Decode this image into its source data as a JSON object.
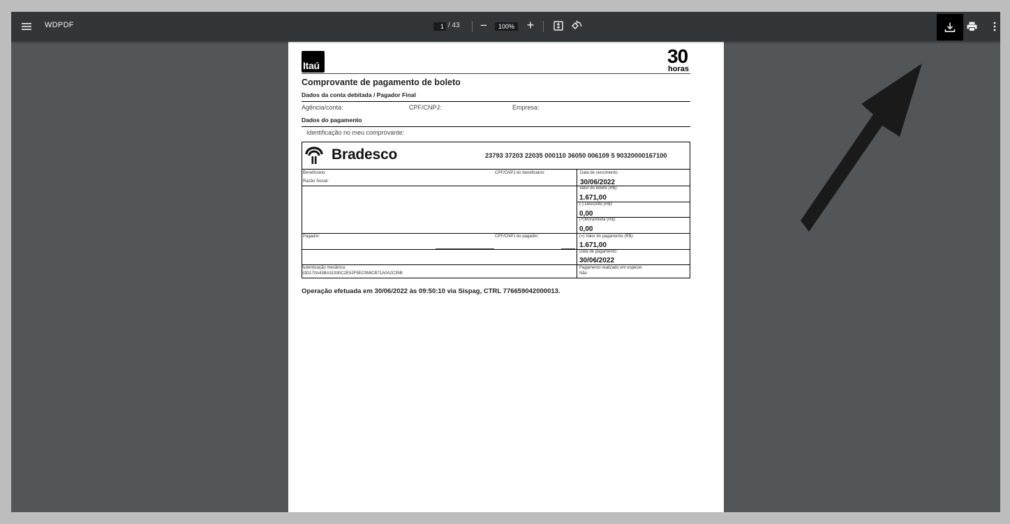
{
  "toolbar": {
    "title": "WDPDF",
    "page_current": "1",
    "page_total": "/ 43",
    "zoom_out": "−",
    "zoom_value": "100%",
    "zoom_in": "+",
    "icons": {
      "menu": "menu-icon",
      "fit": "fit-to-page-icon",
      "rotate": "rotate-icon",
      "download": "download-icon",
      "print": "print-icon",
      "more": "more-vertical-icon"
    }
  },
  "document": {
    "itau_logo": "Itaú",
    "badge_number": "30",
    "badge_word": "horas",
    "heading": "Comprovante de pagamento de boleto",
    "section_debit": "Dados da conta debitada / Pagador Final",
    "agencia_label": "Agência/conta:",
    "cpf_label": "CPF/CNPJ:",
    "empresa_label": "Empresa:",
    "section_payment": "Dados do pagamento",
    "identificacao_label": "Identificação no meu comprovante:",
    "bank_name": "Bradesco",
    "barcode_line": "23793 37203 22035 000110 36050 006109 5 90320000167100",
    "beneficiario_label": "Beneficiário:",
    "razao_social_label": "Razão Social:",
    "cpf_beneficiario_label": "CPF/CNPJ do beneficiário:",
    "vencimento_label": "Data de vencimento:",
    "vencimento_value": "30/06/2022",
    "valor_boleto_label": "Valor do boleto (R$):",
    "valor_boleto_value": "1.671,00",
    "desconto_label": "(-) Desconto (R$):",
    "desconto_value": "0,00",
    "mora_label": "(+)Mora/Multa (R$):",
    "mora_value": "0,00",
    "pagador_label": "Pagador:",
    "cpf_pagador_label": "CPF/CNPJ do pagador:",
    "valor_pagamento_label": "(=) Valor do pagamento (R$):",
    "valor_pagamento_value": "1.671,00",
    "data_pagamento_label": "Data de pagamento:",
    "data_pagamento_value": "30/06/2022",
    "autenticacao_label": "Autenticação mecânica",
    "autenticacao_value": "63D170A43BA31930C2E52F5EC958CB71A0A2C35B",
    "pagamento_especie_label": "Pagamento realizado em espécie:",
    "pagamento_especie_value": "Não",
    "footer_operation": "Operação efetuada em 30/06/2022  às 09:50:10 via Sispag, CTRL 776659042000013."
  },
  "colors": {
    "viewer_bg": "#525659",
    "toolbar_bg": "#323639",
    "outer_bg": "#bdbdbd",
    "arrow": "#1a1a1a"
  },
  "annotation": {
    "icon": "arrow-pointer-icon"
  }
}
